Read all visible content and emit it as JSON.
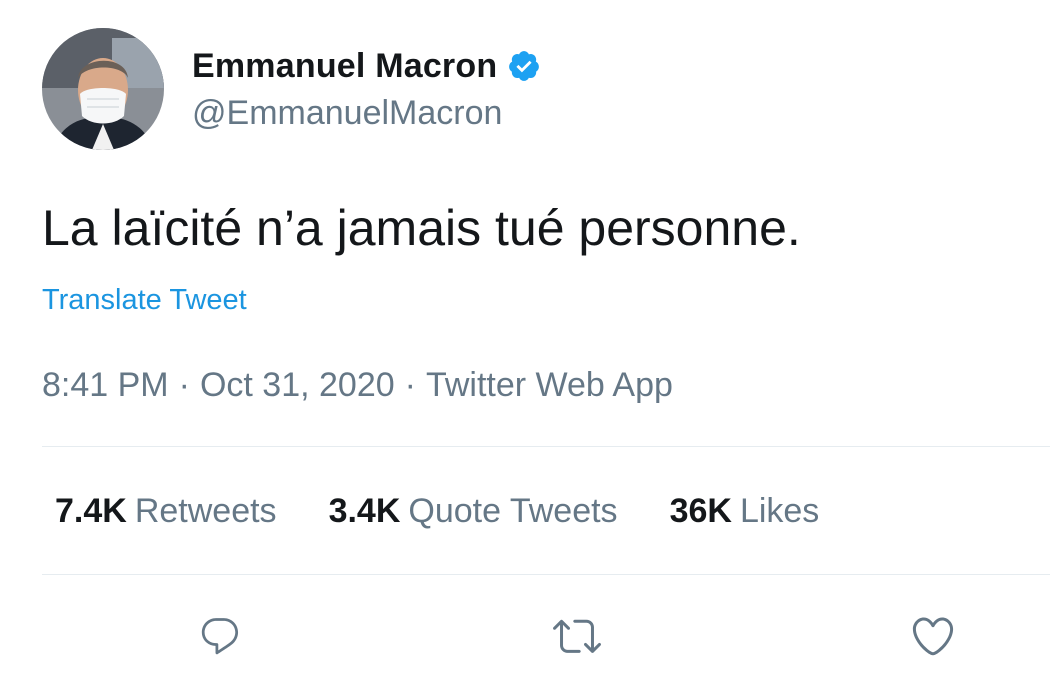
{
  "user": {
    "display_name": "Emmanuel Macron",
    "handle": "@EmmanuelMacron",
    "verified": true
  },
  "tweet": {
    "text": "La laïcité n’a jamais tué personne.",
    "translate_label": "Translate Tweet",
    "time": "8:41 PM",
    "separator": "·",
    "date": "Oct 31, 2020",
    "source": "Twitter Web App"
  },
  "stats": {
    "retweets_count": "7.4K",
    "retweets_label": "Retweets",
    "quotes_count": "3.4K",
    "quotes_label": "Quote Tweets",
    "likes_count": "36K",
    "likes_label": "Likes"
  },
  "actions": {
    "reply_icon": "reply-icon",
    "retweet_icon": "retweet-icon",
    "like_icon": "heart-icon"
  },
  "colors": {
    "link": "#1b95e0",
    "verified": "#1da1f2",
    "secondary_text": "#657786",
    "primary_text": "#14171a",
    "divider": "#e6ecf0"
  }
}
